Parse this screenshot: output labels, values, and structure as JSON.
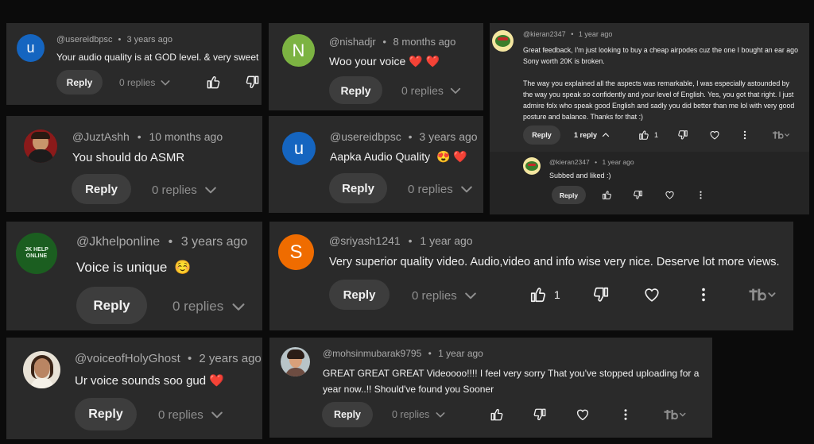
{
  "comments": [
    {
      "handle": "@usereidbpsc",
      "dot": "•",
      "time": "3 years ago",
      "text": "Your audio quality is at GOD level. & very sweet",
      "emoji": "❤️",
      "avatar_letter": "u",
      "avatar_color": "#1565c0",
      "reply": "Reply",
      "replies": "0 replies"
    },
    {
      "handle": "@nishadjr",
      "dot": "•",
      "time": "8 months ago",
      "text": "Woo your voice",
      "emoji": "❤️ ❤️",
      "avatar_letter": "N",
      "avatar_color": "#7cb342",
      "reply": "Reply",
      "replies": "0 replies"
    },
    {
      "handle": "@JuztAshh",
      "dot": "•",
      "time": "10 months ago",
      "text": "You should do ASMR",
      "reply": "Reply",
      "replies": "0 replies"
    },
    {
      "handle": "@usereidbpsc",
      "dot": "•",
      "time": "3 years ago",
      "text": "Aapka Audio Quality",
      "emoji": "😍 ❤️",
      "avatar_letter": "u",
      "avatar_color": "#1565c0",
      "reply": "Reply",
      "replies": "0 replies"
    },
    {
      "handle": "@Jkhelponline",
      "dot": "•",
      "time": "3 years ago",
      "text": "Voice is unique",
      "emoji": "☺️",
      "avatar_text": "JK HELP ONLINE",
      "reply": "Reply",
      "replies": "0 replies"
    },
    {
      "handle": "@sriyash1241",
      "dot": "•",
      "time": "1 year ago",
      "text": "Very superior quality video. Audio,video and info wise very nice. Deserve lot more views.",
      "avatar_letter": "S",
      "avatar_color": "#ef6c00",
      "reply": "Reply",
      "replies": "0 replies",
      "likes": "1"
    },
    {
      "handle": "@voiceofHolyGhost",
      "dot": "•",
      "time": "2 years ago",
      "text": "Ur voice sounds soo gud",
      "emoji": "❤️",
      "reply": "Reply",
      "replies": "0 replies"
    },
    {
      "handle": "@mohsinmubarak9795",
      "dot": "•",
      "time": "1 year ago",
      "text": "GREAT GREAT GREAT Videoooo!!!! I feel very sorry That you've stopped uploading for a",
      "text2": "year now..!! Should've found you Sooner",
      "reply": "Reply",
      "replies": "0 replies"
    }
  ],
  "kieran": {
    "handle": "@kieran2347",
    "dot": "•",
    "time": "1 year ago",
    "lines": [
      "Great feedback, I'm just looking to buy a cheap airpodes cuz the one I bought an ear ago",
      "Sony worth 20K is broken.",
      "",
      "The way you explained all the aspects was remarkable, I was especially astounded by",
      "the way you speak so confidently and your level of English. Yes, you got that right. I just",
      "admire folx who speak good English and sadly you did better than me lol with very good",
      "posture and balance. Thanks for that :)"
    ],
    "reply": "Reply",
    "replies": "1 reply",
    "likes": "1",
    "sub": {
      "handle": "@kieran2347",
      "dot": "•",
      "time": "1 year ago",
      "text": "Subbed and liked :)",
      "reply": "Reply"
    }
  },
  "colors": {
    "card": "#2a2a2a",
    "pill": "#3d3d3d",
    "muted": "#aaaaaa",
    "page": "#0b0b0b"
  },
  "icons": [
    "thumbs-up-icon",
    "thumbs-down-icon",
    "heart-icon",
    "more-vert-icon",
    "chevron-down-icon",
    "chevron-up-icon",
    "translate-icon"
  ]
}
